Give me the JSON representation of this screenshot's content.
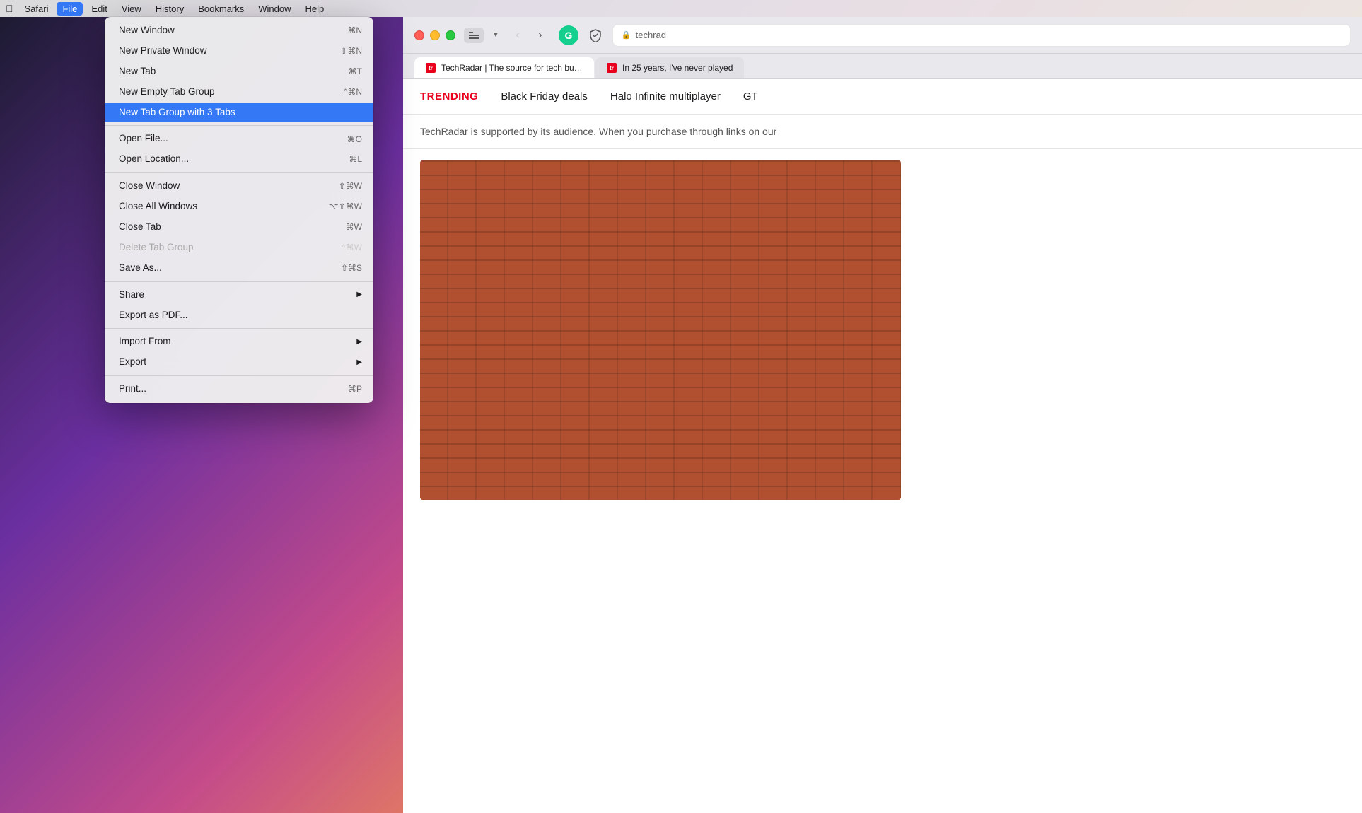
{
  "menubar": {
    "apple_label": "",
    "items": [
      {
        "id": "safari",
        "label": "Safari",
        "active": false
      },
      {
        "id": "file",
        "label": "File",
        "active": true
      },
      {
        "id": "edit",
        "label": "Edit",
        "active": false
      },
      {
        "id": "view",
        "label": "View",
        "active": false
      },
      {
        "id": "history",
        "label": "History",
        "active": false
      },
      {
        "id": "bookmarks",
        "label": "Bookmarks",
        "active": false
      },
      {
        "id": "window",
        "label": "Window",
        "active": false
      },
      {
        "id": "help",
        "label": "Help",
        "active": false
      }
    ]
  },
  "dropdown": {
    "items": [
      {
        "id": "new-window",
        "label": "New Window",
        "shortcut": "⌘N",
        "type": "item"
      },
      {
        "id": "new-private-window",
        "label": "New Private Window",
        "shortcut": "⇧⌘N",
        "type": "item"
      },
      {
        "id": "new-tab",
        "label": "New Tab",
        "shortcut": "⌘T",
        "type": "item"
      },
      {
        "id": "new-empty-tab-group",
        "label": "New Empty Tab Group",
        "shortcut": "^⌘N",
        "type": "item"
      },
      {
        "id": "new-tab-group-with-tabs",
        "label": "New Tab Group with 3 Tabs",
        "shortcut": "",
        "type": "highlighted"
      },
      {
        "id": "sep1",
        "type": "separator"
      },
      {
        "id": "open-file",
        "label": "Open File...",
        "shortcut": "⌘O",
        "type": "item"
      },
      {
        "id": "open-location",
        "label": "Open Location...",
        "shortcut": "⌘L",
        "type": "item"
      },
      {
        "id": "sep2",
        "type": "separator"
      },
      {
        "id": "close-window",
        "label": "Close Window",
        "shortcut": "⇧⌘W",
        "type": "item"
      },
      {
        "id": "close-all-windows",
        "label": "Close All Windows",
        "shortcut": "⌥⇧⌘W",
        "type": "item"
      },
      {
        "id": "close-tab",
        "label": "Close Tab",
        "shortcut": "⌘W",
        "type": "item"
      },
      {
        "id": "delete-tab-group",
        "label": "Delete Tab Group",
        "shortcut": "^⌘W",
        "type": "disabled"
      },
      {
        "id": "save-as",
        "label": "Save As...",
        "shortcut": "⇧⌘S",
        "type": "item"
      },
      {
        "id": "sep3",
        "type": "separator"
      },
      {
        "id": "share",
        "label": "Share",
        "shortcut": "",
        "arrow": "▶",
        "type": "item"
      },
      {
        "id": "export-pdf",
        "label": "Export as PDF...",
        "shortcut": "",
        "type": "item"
      },
      {
        "id": "sep4",
        "type": "separator"
      },
      {
        "id": "import-from",
        "label": "Import From",
        "shortcut": "",
        "arrow": "▶",
        "type": "item"
      },
      {
        "id": "export",
        "label": "Export",
        "shortcut": "",
        "arrow": "▶",
        "type": "item"
      },
      {
        "id": "sep5",
        "type": "separator"
      },
      {
        "id": "print",
        "label": "Print...",
        "shortcut": "⌘P",
        "type": "item"
      }
    ]
  },
  "browser": {
    "address": "techrad",
    "address_lock": "🔒",
    "tabs": [
      {
        "id": "tab1",
        "label": "TechRadar | The source for tech buying advice",
        "favicon": "tr"
      },
      {
        "id": "tab2",
        "label": "In 25 years, I've never played",
        "favicon": "tr"
      }
    ],
    "trending": {
      "label": "TRENDING",
      "items": [
        "Black Friday deals",
        "Halo Infinite multiplayer",
        "GT"
      ]
    },
    "support_text": "TechRadar is supported by its audience. When you purchase through links on our",
    "grammarly_letter": "G"
  }
}
